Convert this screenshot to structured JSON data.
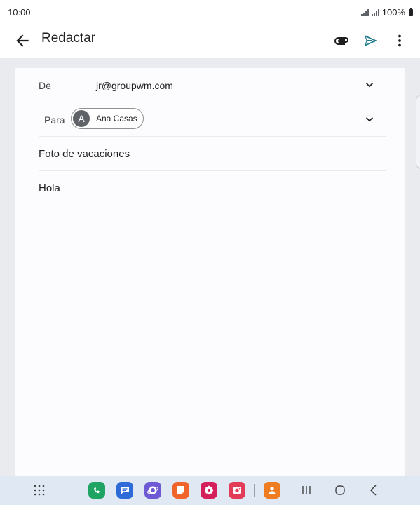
{
  "status_bar": {
    "time": "10:00",
    "battery": "100%"
  },
  "app_bar": {
    "title": "Redactar",
    "icons": [
      "back-arrow-icon",
      "paperclip-icon",
      "send-icon",
      "more-vert-icon"
    ]
  },
  "compose": {
    "from_label": "De",
    "from_value": "jr@groupwm.com",
    "to_label": "Para",
    "recipient": {
      "initial": "A",
      "name": "Ana Casas"
    },
    "subject": "Foto de vacaciones",
    "body": "Hola"
  },
  "colors": {
    "send_icon": "#1f7a8c",
    "phone_app": "#1fa463",
    "messages_app": "#2f6bd8",
    "internet_app": "#6f5ad6",
    "notes_app": "#f0642b",
    "gallery_app": "#d51f5b",
    "camera_app": "#e23c59",
    "contacts_app": "#f07c22"
  },
  "nav_bar": {
    "apps": [
      "apps-grid-icon",
      "phone-icon",
      "messages-icon",
      "internet-icon",
      "notes-icon",
      "gallery-icon",
      "camera-icon",
      "contacts-icon"
    ],
    "system": [
      "recents-icon",
      "home-icon",
      "back-icon"
    ]
  }
}
